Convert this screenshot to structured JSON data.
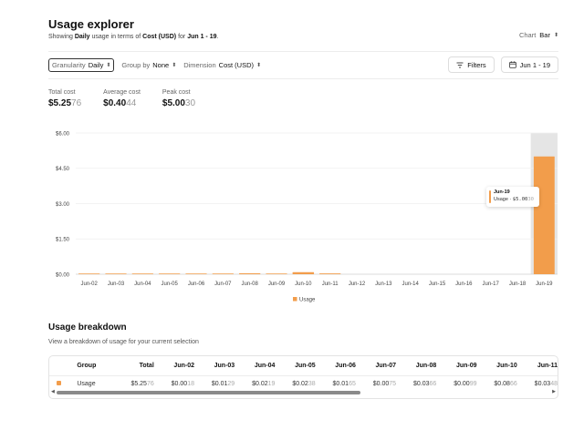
{
  "header": {
    "title": "Usage explorer",
    "subtitle_prefix": "Showing",
    "subtitle_granularity": "Daily",
    "subtitle_mid": "usage in terms of",
    "subtitle_dimension": "Cost (USD)",
    "subtitle_for": "for",
    "subtitle_range": "Jun 1 - 19",
    "subtitle_end": ".",
    "chart_label": "Chart",
    "chart_value": "Bar"
  },
  "controls": {
    "granularity_label": "Granularity",
    "granularity_value": "Daily",
    "group_by_label": "Group by",
    "group_by_value": "None",
    "dimension_label": "Dimension",
    "dimension_value": "Cost (USD)",
    "filters_label": "Filters",
    "date_range_label": "Jun 1 - 19"
  },
  "stats": [
    {
      "label": "Total cost",
      "main": "$5.25",
      "dim": "76"
    },
    {
      "label": "Average cost",
      "main": "$0.40",
      "dim": "44"
    },
    {
      "label": "Peak cost",
      "main": "$5.00",
      "dim": "30"
    }
  ],
  "colors": {
    "accent": "#f29d4b",
    "highlight_band": "#e5e5e5"
  },
  "chart_data": {
    "type": "bar",
    "categories": [
      "Jun-02",
      "Jun-03",
      "Jun-04",
      "Jun-05",
      "Jun-06",
      "Jun-07",
      "Jun-08",
      "Jun-09",
      "Jun-10",
      "Jun-11",
      "Jun-12",
      "Jun-13",
      "Jun-14",
      "Jun-15",
      "Jun-16",
      "Jun-17",
      "Jun-18",
      "Jun-19"
    ],
    "series": [
      {
        "name": "Usage",
        "values": [
          0.0018,
          0.0129,
          0.0219,
          0.0238,
          0.0165,
          0.0075,
          0.0366,
          0.0099,
          0.0866,
          0.0348,
          0,
          0,
          0,
          0,
          0,
          0,
          0,
          5.003
        ]
      }
    ],
    "yticks": [
      "$0.00",
      "$1.50",
      "$3.00",
      "$4.50",
      "$6.00"
    ],
    "ylim": [
      0,
      6
    ],
    "highlighted": "Jun-19",
    "legend": "bottom",
    "grid": true
  },
  "tooltip": {
    "date": "Jun-19",
    "label": "Usage",
    "main": "$5.00",
    "dim": "30"
  },
  "breakdown": {
    "title": "Usage breakdown",
    "subtitle": "View a breakdown of usage for your current selection",
    "columns": [
      "Group",
      "Total",
      "Jun-02",
      "Jun-03",
      "Jun-04",
      "Jun-05",
      "Jun-06",
      "Jun-07",
      "Jun-08",
      "Jun-09",
      "Jun-10",
      "Jun-11"
    ],
    "row": {
      "group": "Usage",
      "cells": [
        {
          "main": "$5.25",
          "dim": "76"
        },
        {
          "main": "$0.00",
          "dim": "18"
        },
        {
          "main": "$0.01",
          "dim": "29"
        },
        {
          "main": "$0.02",
          "dim": "19"
        },
        {
          "main": "$0.02",
          "dim": "38"
        },
        {
          "main": "$0.01",
          "dim": "65"
        },
        {
          "main": "$0.00",
          "dim": "75"
        },
        {
          "main": "$0.03",
          "dim": "66"
        },
        {
          "main": "$0.00",
          "dim": "99"
        },
        {
          "main": "$0.08",
          "dim": "66"
        },
        {
          "main": "$0.03",
          "dim": "48"
        }
      ]
    }
  }
}
